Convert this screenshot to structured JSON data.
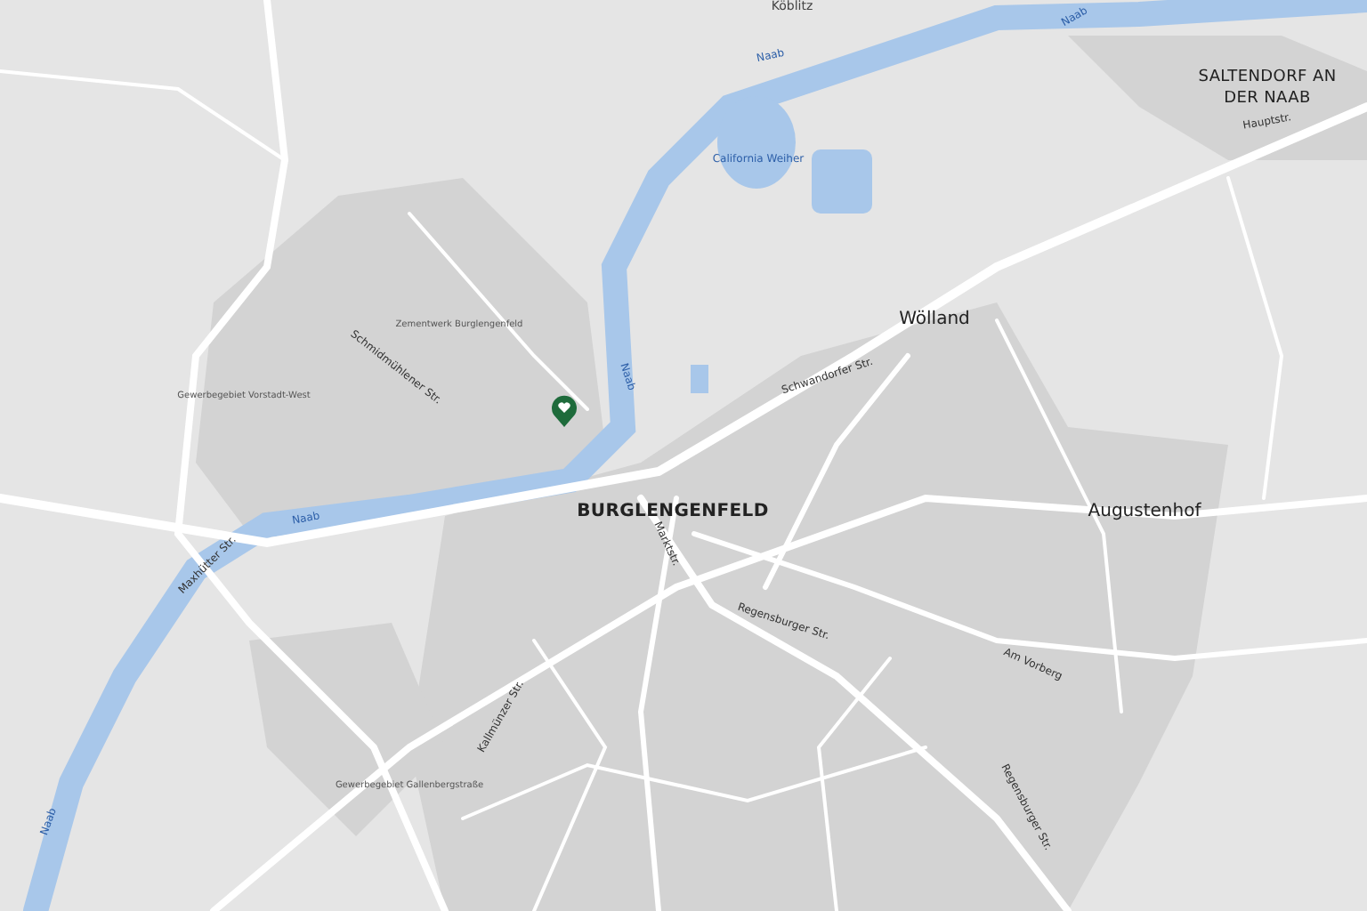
{
  "map": {
    "labels": [
      {
        "text": "Köblitz",
        "kind": "village"
      },
      {
        "text": "Naab",
        "kind": "water"
      },
      {
        "text": "Naab",
        "kind": "water"
      },
      {
        "text": "California Weiher",
        "kind": "water"
      },
      {
        "text": "SALTENDORF AN DER NAAB",
        "kind": "city"
      },
      {
        "text": "Hauptstr.",
        "kind": "street"
      },
      {
        "text": "Wölland",
        "kind": "town"
      },
      {
        "text": "Schwandorfer Str.",
        "kind": "street"
      },
      {
        "text": "Zementwerk Burglengenfeld",
        "kind": "area"
      },
      {
        "text": "Gewerbegebiet Vorstadt-West",
        "kind": "area"
      },
      {
        "text": "Schmidmühlener Str.",
        "kind": "street"
      },
      {
        "text": "Naab",
        "kind": "water"
      },
      {
        "text": "Naab",
        "kind": "water"
      },
      {
        "text": "Maxhütter Str.",
        "kind": "street"
      },
      {
        "text": "BURGLENGENFELD",
        "kind": "city"
      },
      {
        "text": "Augustenhof",
        "kind": "town"
      },
      {
        "text": "Marktstr.",
        "kind": "street"
      },
      {
        "text": "Regensburger Str.",
        "kind": "street"
      },
      {
        "text": "Am Vorberg",
        "kind": "street"
      },
      {
        "text": "Kallmünzer Str.",
        "kind": "street"
      },
      {
        "text": "Regensburger Str.",
        "kind": "street"
      },
      {
        "text": "Naab",
        "kind": "water"
      },
      {
        "text": "Gewerbegebiet Gallenbergstraße",
        "kind": "area"
      }
    ],
    "marker": {
      "shown": true
    }
  }
}
